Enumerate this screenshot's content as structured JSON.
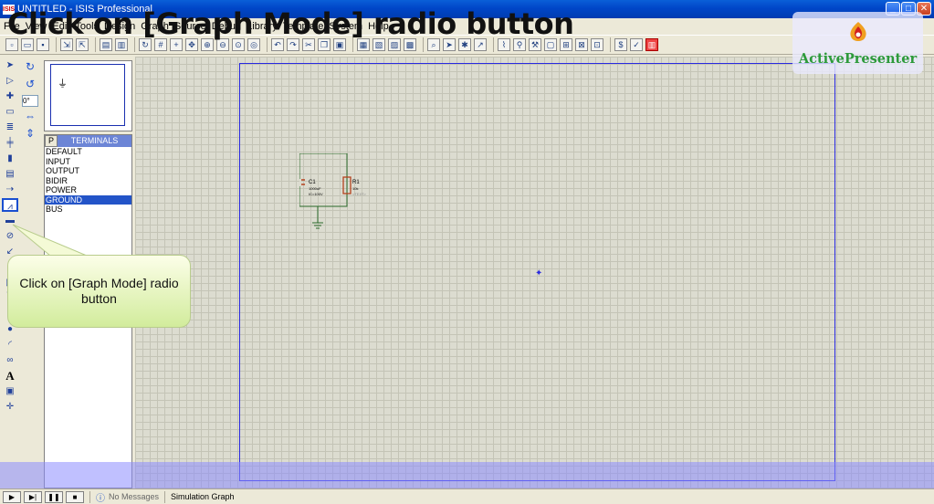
{
  "window": {
    "title": "UNTITLED - ISIS Professional",
    "app_icon": "ISIS",
    "controls": [
      "_",
      "□",
      "✕"
    ]
  },
  "menubar": {
    "items": [
      "File",
      "View",
      "Edit",
      "Tools",
      "Design",
      "Graph",
      "Source",
      "Debug",
      "Library",
      "Template",
      "System",
      "Help"
    ]
  },
  "overlay": {
    "title": "Click on [Graph Mode] radio button",
    "callout": "Click on [Graph Mode] radio button",
    "brand": "ActivePresenter"
  },
  "rotation": {
    "angle": "0°"
  },
  "selector": {
    "p_button": "P",
    "header": "TERMINALS",
    "items": [
      "DEFAULT",
      "INPUT",
      "OUTPUT",
      "BIDIR",
      "POWER",
      "GROUND",
      "BUS"
    ],
    "selected_index": 5
  },
  "circuit": {
    "c1_ref": "C1",
    "c1_value": "1000uF",
    "c1_ic": "IC=100V",
    "r1_ref": "R1",
    "r1_value": "10k",
    "r1_text": "<TEXT>"
  },
  "status": {
    "messages": "No Messages",
    "hint": "Simulation Graph"
  },
  "colors": {
    "accent": "#2354c8",
    "brand": "#2d9a3a",
    "sheet_border": "#2a2ae0"
  }
}
